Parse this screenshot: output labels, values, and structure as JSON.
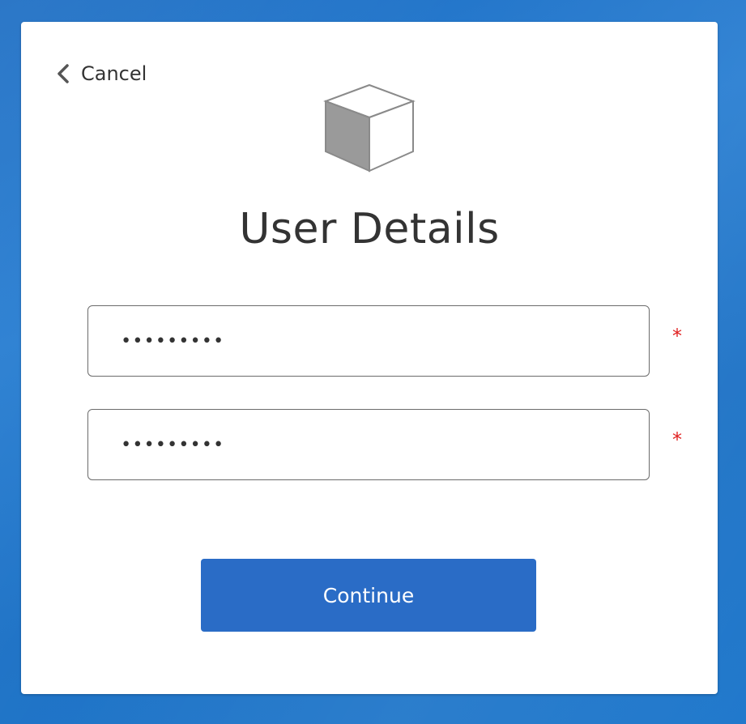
{
  "cancel": {
    "label": "Cancel",
    "icon": "chevron-left-icon"
  },
  "logo": {
    "icon": "cube-icon"
  },
  "title": "User Details",
  "fields": [
    {
      "value": "•••••••••",
      "required_mark": "*"
    },
    {
      "value": "•••••••••",
      "required_mark": "*"
    }
  ],
  "continue": {
    "label": "Continue"
  },
  "colors": {
    "background": "#1f73c6",
    "card": "#ffffff",
    "button": "#2a6cc6",
    "required": "#e02020",
    "text": "#333333"
  }
}
